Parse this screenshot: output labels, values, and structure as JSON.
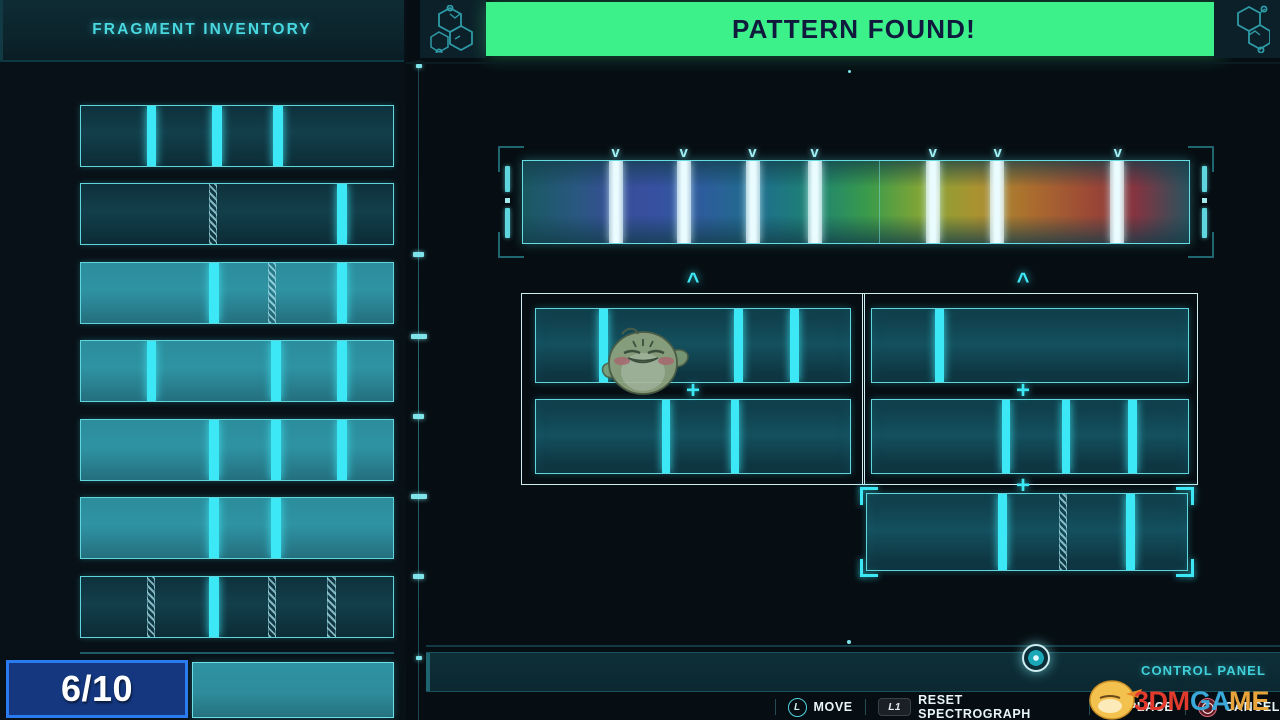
{
  "theme": {
    "bg": "#060e13",
    "panel_bg": "#081117",
    "accent_cyan": "#3ce8f5",
    "border_cyan": "#5fd6dd",
    "banner_green": "#3cf08a",
    "banner_text": "#101a3c",
    "counter_blue": "#14377f",
    "counter_border": "#2b7bf0"
  },
  "left_panel": {
    "header": {
      "title": "FRAGMENT INVENTORY"
    },
    "fragments": [
      {
        "name": "fragment-1",
        "state": "dark",
        "bands": [
          {
            "x": 21.0,
            "w": 3.2,
            "type": "solid"
          },
          {
            "x": 42.0,
            "w": 3.2,
            "type": "solid"
          },
          {
            "x": 61.5,
            "w": 3.2,
            "type": "solid"
          }
        ]
      },
      {
        "name": "fragment-2",
        "state": "dark",
        "bands": [
          {
            "x": 41.0,
            "w": 2.6,
            "type": "hatch"
          },
          {
            "x": 82.0,
            "w": 3.2,
            "type": "solid"
          }
        ]
      },
      {
        "name": "fragment-3",
        "state": "lit",
        "bands": [
          {
            "x": 41.0,
            "w": 3.2,
            "type": "solid"
          },
          {
            "x": 60.0,
            "w": 2.6,
            "type": "hatch"
          },
          {
            "x": 82.0,
            "w": 3.2,
            "type": "solid"
          }
        ]
      },
      {
        "name": "fragment-4",
        "state": "lit",
        "bands": [
          {
            "x": 21.0,
            "w": 3.2,
            "type": "solid"
          },
          {
            "x": 61.0,
            "w": 3.2,
            "type": "solid"
          },
          {
            "x": 82.0,
            "w": 3.2,
            "type": "solid"
          }
        ]
      },
      {
        "name": "fragment-5",
        "state": "lit",
        "bands": [
          {
            "x": 41.0,
            "w": 3.2,
            "type": "solid"
          },
          {
            "x": 61.0,
            "w": 3.2,
            "type": "solid"
          },
          {
            "x": 82.0,
            "w": 3.2,
            "type": "solid"
          }
        ]
      },
      {
        "name": "fragment-6",
        "state": "lit",
        "bands": [
          {
            "x": 41.0,
            "w": 3.2,
            "type": "solid"
          },
          {
            "x": 61.0,
            "w": 3.2,
            "type": "solid"
          }
        ]
      },
      {
        "name": "fragment-7",
        "state": "dark",
        "bands": [
          {
            "x": 21.0,
            "w": 2.6,
            "type": "hatch"
          },
          {
            "x": 41.0,
            "w": 3.2,
            "type": "solid"
          },
          {
            "x": 60.0,
            "w": 2.6,
            "type": "hatch"
          },
          {
            "x": 79.0,
            "w": 2.6,
            "type": "hatch"
          }
        ]
      }
    ],
    "counter": {
      "label": "6/10",
      "current": 6,
      "total": 10
    }
  },
  "top_bar": {
    "banner_text": "PATTERN FOUND!",
    "left_icon": "molecule-hexagon-icon",
    "right_icon": "molecule-hexagon-icon"
  },
  "spectrum": {
    "name": "spectrograph-readout",
    "absorption_lines_pct": [
      14.0,
      24.2,
      34.5,
      43.8,
      61.5,
      71.2,
      89.2
    ],
    "chevrons_pct": [
      14.0,
      24.2,
      34.5,
      43.8,
      61.5,
      71.2,
      89.2
    ],
    "divider_pct": [
      53.5
    ],
    "gradient": "violet-blue-teal-green-yellow-orange-red"
  },
  "workspace": {
    "groups": [
      {
        "name": "assembly-group-left",
        "caret": "^",
        "rows": [
          {
            "name": "assembly-slot-1",
            "bands": [
              {
                "x": 20.0,
                "w": 2.8
              },
              {
                "x": 63.0,
                "w": 2.8
              },
              {
                "x": 81.0,
                "w": 2.8
              }
            ]
          },
          {
            "name": "assembly-slot-2",
            "bands": [
              {
                "x": 40.0,
                "w": 2.8
              },
              {
                "x": 62.0,
                "w": 2.8
              }
            ]
          }
        ],
        "plus": "+"
      },
      {
        "name": "assembly-group-right",
        "caret": "^",
        "rows": [
          {
            "name": "assembly-slot-3",
            "bands": [
              {
                "x": 20.0,
                "w": 2.8
              }
            ]
          },
          {
            "name": "assembly-slot-4",
            "bands": [
              {
                "x": 41.0,
                "w": 2.8
              },
              {
                "x": 60.0,
                "w": 2.8
              },
              {
                "x": 81.0,
                "w": 2.8
              }
            ]
          }
        ],
        "plus": "+"
      }
    ],
    "selected_slot": {
      "name": "assembly-slot-selected",
      "bands": [
        {
          "x": 41.0,
          "w": 2.8,
          "type": "solid"
        },
        {
          "x": 60.0,
          "w": 2.4,
          "type": "hatch"
        },
        {
          "x": 81.0,
          "w": 2.8,
          "type": "solid"
        }
      ],
      "plus": "+"
    },
    "cursor_icon": "bird-mascot-cursor"
  },
  "control_panel": {
    "label": "CONTROL PANEL",
    "indicator_icon": "target-orb-icon"
  },
  "hints": [
    {
      "button": "L",
      "button_icon": "left-stick-icon",
      "label": "MOVE"
    },
    {
      "button": "L1",
      "button_icon": "l1-shoulder-icon",
      "label": "RESET SPECTROGRAPH"
    },
    {
      "button": "X",
      "button_icon": "cross-button-icon",
      "label": "PLACE"
    },
    {
      "button": "O",
      "button_icon": "circle-button-icon",
      "label": "CANCEL"
    }
  ],
  "watermark": {
    "text_1": "3DM",
    "text_2": "GAME",
    "icon": "chick-mascot-icon"
  }
}
